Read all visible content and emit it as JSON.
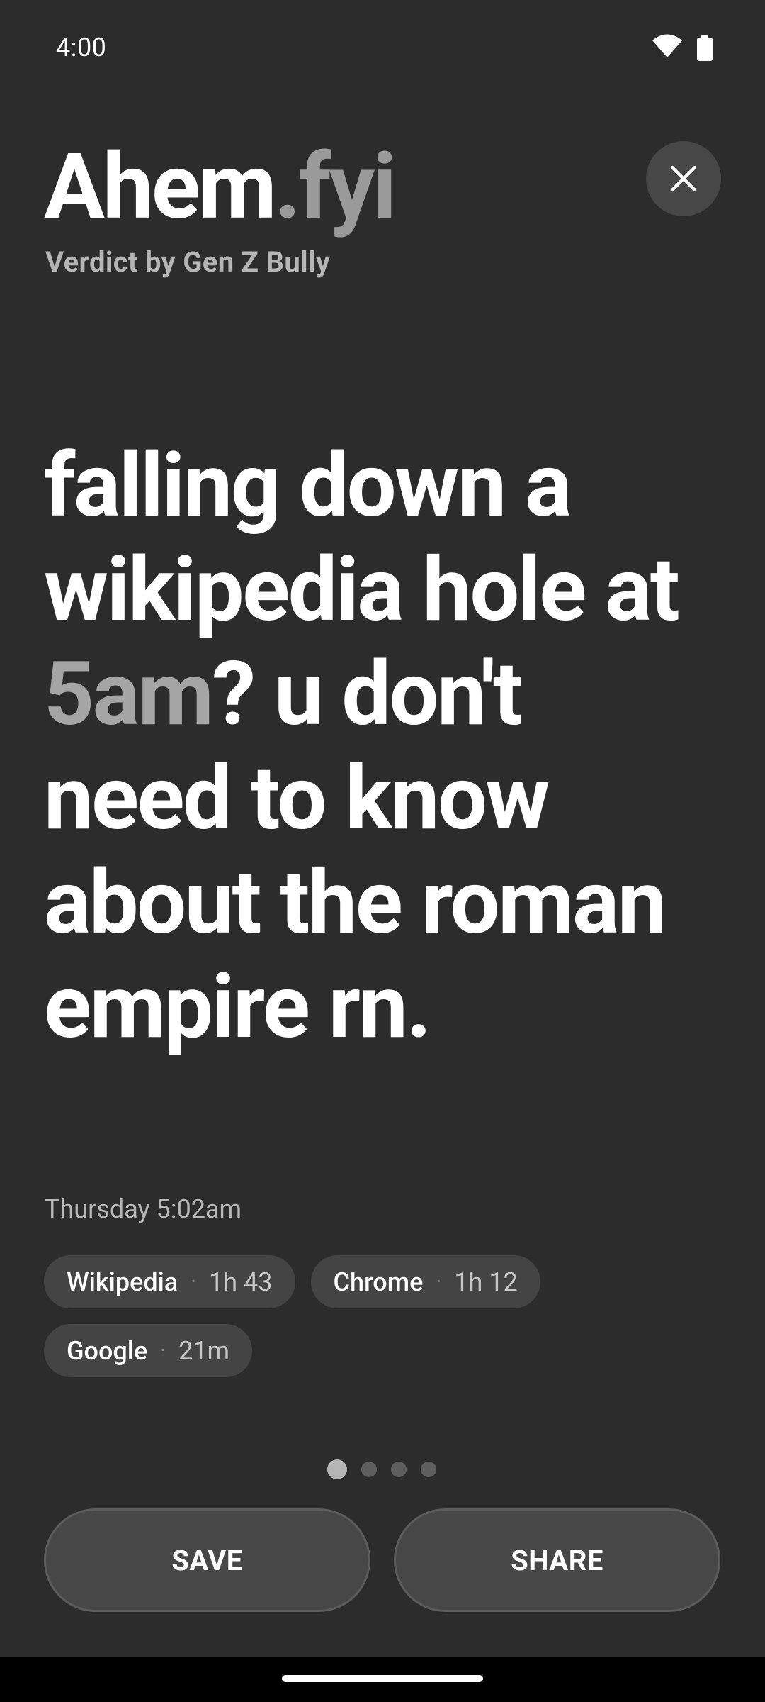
{
  "status_bar": {
    "time": "4:00",
    "icons": [
      "wifi-icon",
      "battery-icon"
    ]
  },
  "header": {
    "brand_main": "Ahem",
    "brand_suffix": ".fyi",
    "subtitle": "Verdict by Gen Z Bully",
    "close_icon": "close-icon"
  },
  "verdict": {
    "part1": "falling down a wikipedia hole at ",
    "highlight": "5am",
    "part2": "? u don't need to know about the roman empire rn."
  },
  "session": {
    "day_label": "Thursday 5:02am",
    "separator": "·",
    "apps": [
      {
        "name": "Wikipedia",
        "duration": "1h 43"
      },
      {
        "name": "Chrome",
        "duration": "1h 12"
      },
      {
        "name": "Google",
        "duration": "21m"
      }
    ]
  },
  "pager": {
    "total_pages": 4,
    "active_page": 1
  },
  "actions": {
    "save_label": "SAVE",
    "share_label": "SHARE"
  },
  "colors": {
    "background": "#2c2c2c",
    "highlight": "#a5a5a5",
    "chip_bg": "#444444",
    "button_bg": "#474747"
  }
}
